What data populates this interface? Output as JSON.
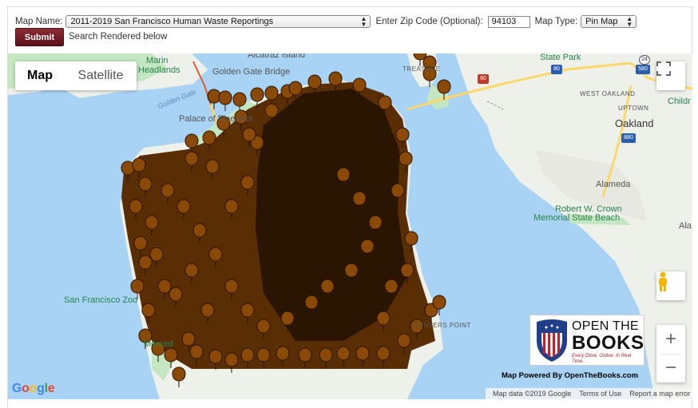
{
  "form": {
    "map_name_label": "Map Name:",
    "map_name_value": "2011-2019 San Francisco Human Waste Reportings",
    "zip_label": "Enter Zip Code (Optional):",
    "zip_value": "94103",
    "map_type_label": "Map Type:",
    "map_type_value": "Pin Map",
    "submit_label": "Submit",
    "rendered_text": "Search Rendered below"
  },
  "map": {
    "type_map": "Map",
    "type_satellite": "Satellite",
    "labels": {
      "marin": "Marin",
      "headlands": "Headlands",
      "golden_gate_bridge": "Golden Gate Bridge",
      "alcatraz": "Alcatraz Island",
      "treasure": "TREASURE",
      "state_park": "State Park",
      "golden_gate": "Golden Gate",
      "palace": "Palace of Fine Arts",
      "west_oakland": "WEST OAKLAND",
      "uptown": "UPTOWN",
      "childr": "Childr",
      "oakland": "Oakland",
      "alameda": "Alameda",
      "crown1": "Robert W. Crown",
      "crown2": "Memorial State Beach",
      "ala": "Ala",
      "sf_zoo": "San Francisco Zoo",
      "merced": "Merced",
      "hunters_point": "HUNTERS POINT",
      "hwy80": "80",
      "hwy24": "24",
      "hwy580": "580",
      "hwy880": "880"
    },
    "zoom_in": "+",
    "zoom_out": "−",
    "google_letters": [
      "G",
      "o",
      "o",
      "g",
      "l",
      "e"
    ],
    "attribution": [
      "Map data ©2019 Google",
      "Terms of Use",
      "Report a map error"
    ]
  },
  "logo": {
    "line1": "OPEN THE",
    "line2": "BOOKS",
    "line3": "Every Dime. Online. In Real Time.",
    "powered": "Map Powered By OpenTheBooks.com"
  },
  "colors": {
    "water": "#a9d3f4",
    "land": "#eef0ea",
    "park": "#c4e6c0",
    "pin": "#8a4a06",
    "pin_outline": "#2a1200",
    "highway": "#fcd76a",
    "submit": "#7a1f27"
  }
}
